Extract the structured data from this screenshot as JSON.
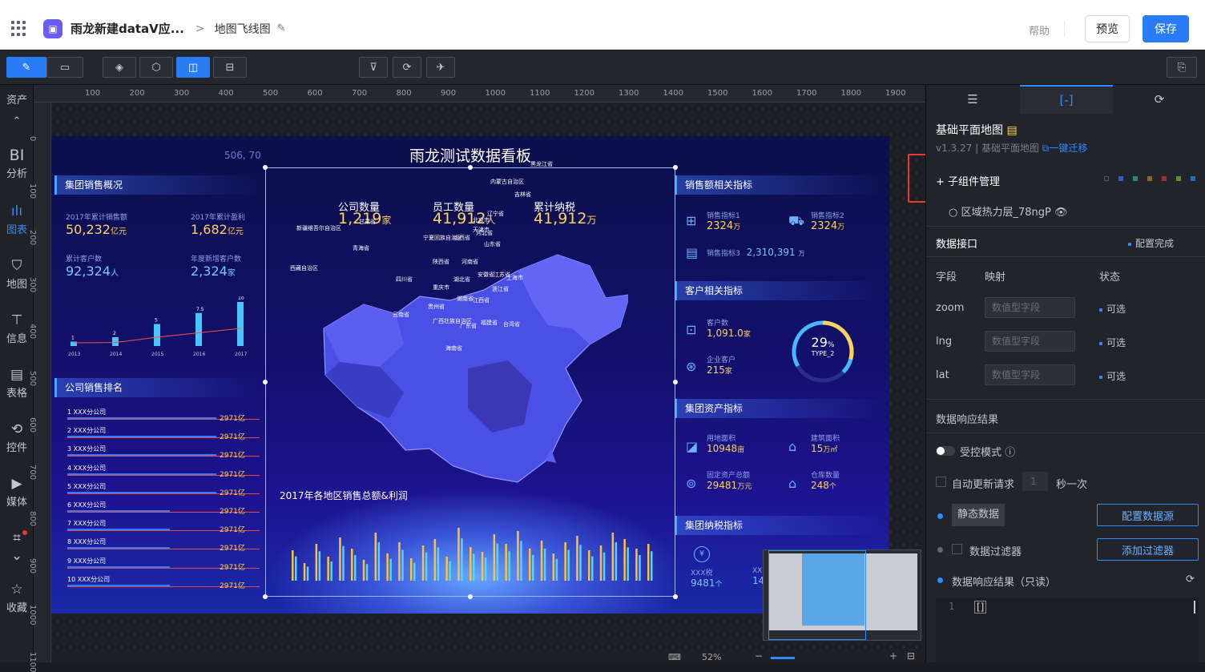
{
  "topbar": {
    "app_title": "雨龙新建dataV应...",
    "separator": ">",
    "page_name": "地图飞线图",
    "help": "帮助",
    "preview": "预览",
    "save": "保存"
  },
  "leftnav": {
    "assets": "资产",
    "items": [
      {
        "label": "BI",
        "sub": "分析"
      },
      {
        "label": "图表"
      },
      {
        "label": "地图"
      },
      {
        "label": "信息"
      },
      {
        "label": "表格"
      },
      {
        "label": "控件"
      },
      {
        "label": "媒体"
      },
      {
        "label": "收藏"
      }
    ]
  },
  "ruler": {
    "top": [
      "100",
      "200",
      "300",
      "400",
      "500",
      "600",
      "700",
      "800",
      "900",
      "1000",
      "1100",
      "1200",
      "1300",
      "1400",
      "1500",
      "1600",
      "1700",
      "1800",
      "1900"
    ],
    "left": [
      "0",
      "100",
      "200",
      "300",
      "400",
      "500",
      "600",
      "700",
      "800",
      "900",
      "1000",
      "1100"
    ]
  },
  "dashboard": {
    "title": "雨龙测试数据看板",
    "coords": "506, 70",
    "overview": {
      "header": "集团销售概况",
      "s1_label": "2017年累计销售额",
      "s1_value": "50,232",
      "s1_unit": "亿元",
      "s2_label": "2017年累计盈利",
      "s2_value": "1,682",
      "s2_unit": "亿元",
      "s3_label": "累计客户数",
      "s3_value": "92,324",
      "s3_unit": "人",
      "s4_label": "年度新增客户数",
      "s4_value": "2,324",
      "s4_unit": "家"
    },
    "ranking": {
      "header": "公司销售排名",
      "rows": [
        {
          "n": "1",
          "name": "XXX分公司",
          "val": "2971亿"
        },
        {
          "n": "2",
          "name": "XXX分公司",
          "val": "2971亿"
        },
        {
          "n": "3",
          "name": "XXX分公司",
          "val": "2971亿"
        },
        {
          "n": "4",
          "name": "XXX分公司",
          "val": "2971亿"
        },
        {
          "n": "5",
          "name": "XXX分公司",
          "val": "2971亿"
        },
        {
          "n": "6",
          "name": "XXX分公司",
          "val": "2971亿"
        },
        {
          "n": "7",
          "name": "XXX分公司",
          "val": "2971亿"
        },
        {
          "n": "8",
          "name": "XXX分公司",
          "val": "2971亿"
        },
        {
          "n": "9",
          "name": "XXX分公司",
          "val": "2971亿"
        },
        {
          "n": "10",
          "name": "XXX分公司",
          "val": "2971亿"
        }
      ]
    },
    "center_stats": [
      {
        "label": "公司数量",
        "value": "1,219",
        "unit": "家"
      },
      {
        "label": "员工数量",
        "value": "41,912",
        "unit": "人"
      },
      {
        "label": "累计纳税",
        "value": "41,912",
        "unit": "万"
      }
    ],
    "bottom_chart_title": "2017年各地区销售总额&利润",
    "sales": {
      "header": "销售额相关指标",
      "m1_label": "销售指标1",
      "m1_value": "2324",
      "m1_unit": "万",
      "m2_label": "销售指标2",
      "m2_value": "2324",
      "m2_unit": "万",
      "m3_label": "销售指标3",
      "m3_value": "2,310,391",
      "m3_unit": "万"
    },
    "customer": {
      "header": "客户相关指标",
      "c1_label": "客户数",
      "c1_value": "1,091.0",
      "c1_unit": "家",
      "c2_label": "企业客户",
      "c2_value": "215",
      "c2_unit": "家",
      "pct": "29",
      "pct_unit": "%",
      "type": "TYPE_2"
    },
    "assets": {
      "header": "集团资产指标",
      "a1_label": "用地面积",
      "a1_value": "10948",
      "a1_unit": "亩",
      "a2_label": "建筑面积",
      "a2_value": "15",
      "a2_unit": "万㎡",
      "a3_label": "固定资产总额",
      "a3_value": "29481",
      "a3_unit": "万元",
      "a4_label": "仓库数量",
      "a4_value": "248",
      "a4_unit": "个"
    },
    "tax": {
      "header": "集团纳税指标",
      "t1_label": "XXX税",
      "t1_value": "9481",
      "t1_unit": "个",
      "t2_label": "XX",
      "t2_value": "14"
    },
    "line_chart": {
      "years": [
        "2013",
        "2014",
        "2015",
        "2016",
        "2017"
      ],
      "values": [
        1,
        2,
        5,
        7.5,
        10
      ]
    },
    "provinces": [
      "新疆维吾尔自治区",
      "西藏自治区",
      "青海省",
      "甘肃省",
      "内蒙古自治区",
      "黑龙江省",
      "吉林省",
      "辽宁省",
      "北京市",
      "天津市",
      "河北省",
      "山西省",
      "山东省",
      "宁夏回族自治区",
      "陕西省",
      "河南省",
      "江苏省",
      "上海市",
      "安徽省",
      "湖北省",
      "四川省",
      "重庆市",
      "浙江省",
      "湖南省",
      "江西省",
      "贵州省",
      "福建省",
      "云南省",
      "广西壮族自治区",
      "广东省",
      "台湾省",
      "海南省"
    ]
  },
  "rightpanel": {
    "tabs": [
      "settings",
      "data",
      "interaction"
    ],
    "comp_name": "基础平面地图",
    "version": "v1.3.27 | 基础平面地图",
    "migrate": "一键迁移",
    "sub_manage": "+ 子组件管理",
    "layer": "区域热力层_78ngP",
    "data_api": "数据接口",
    "config_done": "配置完成",
    "col_field": "字段",
    "col_map": "映射",
    "col_status": "状态",
    "fields": [
      {
        "name": "zoom",
        "placeholder": "数值型字段",
        "status": "可选"
      },
      {
        "name": "lng",
        "placeholder": "数值型字段",
        "status": "可选"
      },
      {
        "name": "lat",
        "placeholder": "数值型字段",
        "status": "可选"
      }
    ],
    "result_title": "数据响应结果",
    "controlled": "受控模式",
    "auto_update": "自动更新请求",
    "interval": "1",
    "per_sec": "秒一次",
    "static_data": "静态数据",
    "config_source": "配置数据源",
    "filter": "数据过滤器",
    "add_filter": "添加过滤器",
    "readonly": "数据响应结果（只读）",
    "line_no": "1",
    "code": "[]"
  },
  "bottom": {
    "zoom": "52%"
  }
}
